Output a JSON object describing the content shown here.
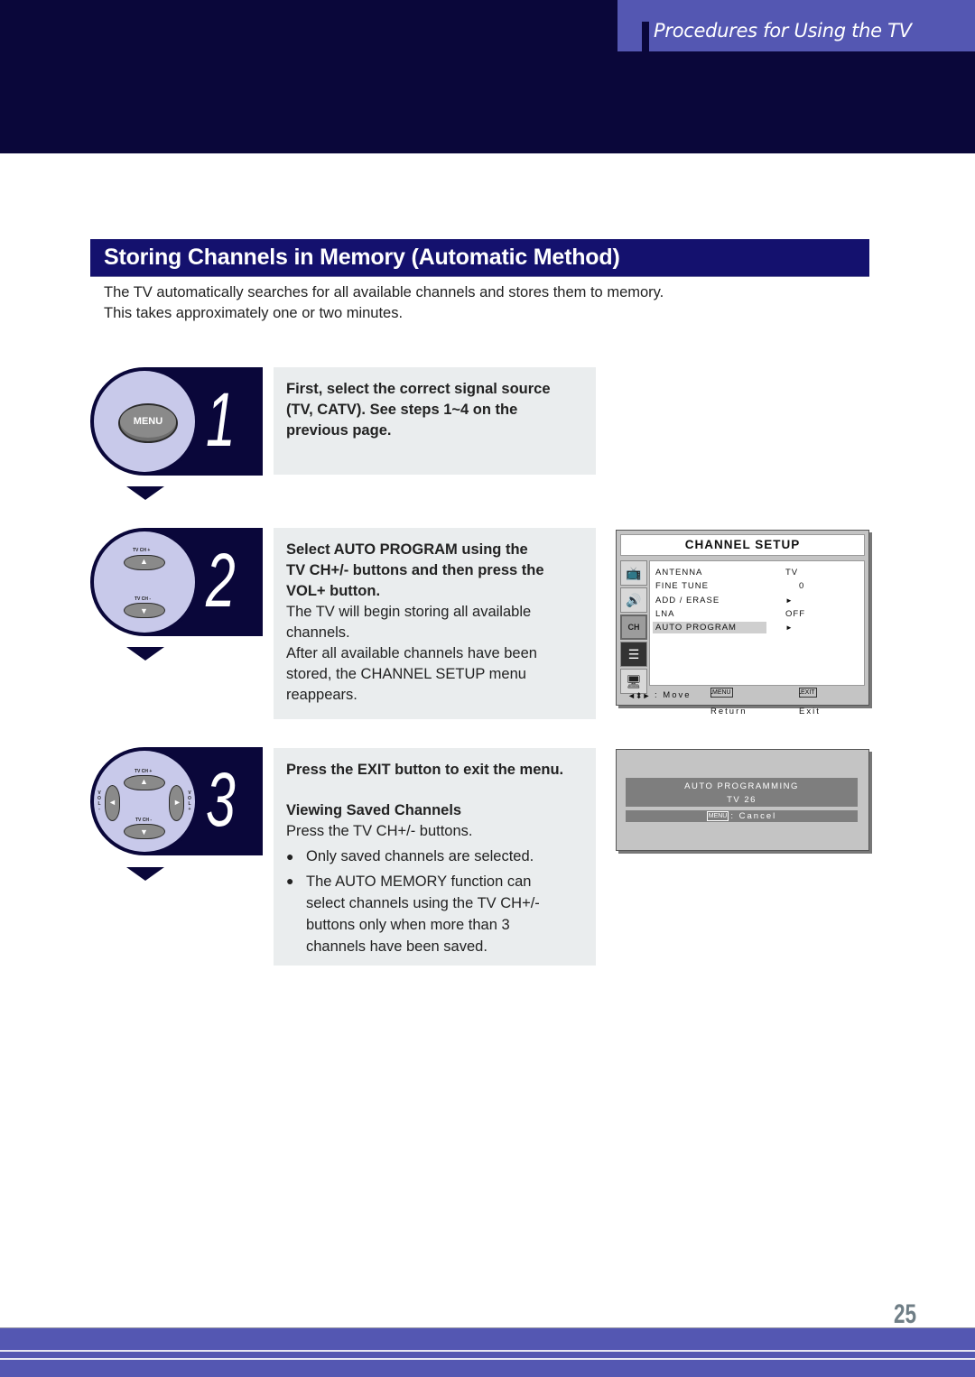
{
  "header": {
    "title": "Procedures for Using the TV"
  },
  "section": {
    "title": "Storing Channels in Memory (Automatic Method)",
    "intro": [
      "The TV automatically searches for all available channels and stores them to memory.",
      "This takes approximately one or two minutes."
    ]
  },
  "steps": [
    {
      "number": "1",
      "remote": {
        "button_label": "MENU"
      },
      "lines_bold": [
        "First, select the correct signal source",
        "(TV, CATV). See steps 1~4 on the",
        "previous page."
      ]
    },
    {
      "number": "2",
      "remote": {
        "ch_up": "TV CH +",
        "ch_down": "TV CH -"
      },
      "lines_bold": [
        "Select AUTO PROGRAM using the",
        "TV CH+/- buttons and then press the",
        "VOL+ button."
      ],
      "lines_normal": [
        "The TV will begin storing all available",
        "channels.",
        "After all available channels have been",
        "stored, the CHANNEL SETUP menu",
        "reappears."
      ]
    },
    {
      "number": "3",
      "remote": {
        "ch_up": "TV CH +",
        "ch_down": "TV CH -",
        "vol_minus": "VOL-",
        "vol_plus": "VOL+"
      },
      "lines_bold": [
        "Press the EXIT button to exit the menu."
      ],
      "subheading": "Viewing Saved Channels",
      "subtext": "Press the TV CH+/- buttons.",
      "bullets": [
        {
          "symbol": "●",
          "lines": [
            "Only saved channels are selected."
          ]
        },
        {
          "symbol": "●",
          "lines": [
            "The AUTO MEMORY function can",
            "select channels using the TV CH+/-",
            "buttons only when more than 3",
            "channels have been saved."
          ]
        }
      ]
    }
  ],
  "channel_setup_screen": {
    "title": "CHANNEL  SETUP",
    "side_icons": [
      "tv-picture-icon",
      "sound-speaker-icon",
      "channel-antenna-icon",
      "function-setup-icon",
      "pc-monitor-icon"
    ],
    "items": [
      {
        "label": "ANTENNA",
        "value": "TV"
      },
      {
        "label": "FINE TUNE",
        "value": "0"
      },
      {
        "label": "ADD / ERASE",
        "value": "►"
      },
      {
        "label": "LNA",
        "value": "OFF"
      },
      {
        "label": "AUTO PROGRAM",
        "value": "►",
        "selected": true
      }
    ],
    "footer": {
      "move_symbol": "◄⬍►",
      "move": ": Move",
      "menu_key": "MENU",
      "return": ": Return",
      "exit_key": "EXIT",
      "exit": ": Exit"
    }
  },
  "auto_programming_screen": {
    "title": "AUTO PROGRAMMING",
    "channel": "TV 26",
    "cancel_key": "MENU",
    "cancel": ": Cancel"
  },
  "footer": {
    "page_number": "25"
  }
}
